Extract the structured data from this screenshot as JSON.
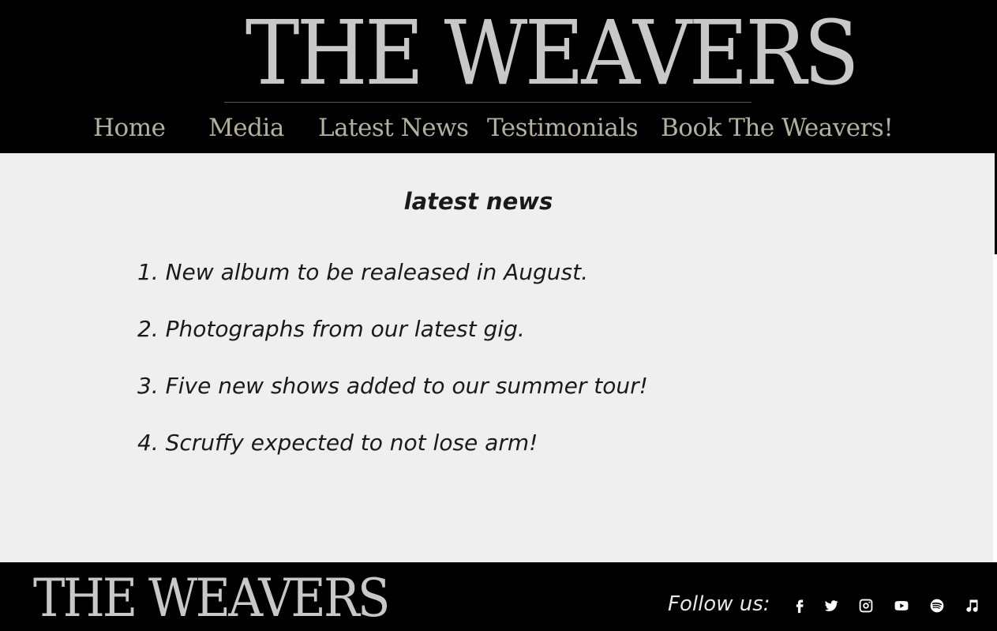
{
  "header": {
    "logo_text": "THE WEAVERS"
  },
  "nav": {
    "items": [
      {
        "label": "Home"
      },
      {
        "label": "Media"
      },
      {
        "label": "Latest News"
      },
      {
        "label": "Testimonials"
      },
      {
        "label": "Book The Weavers!"
      }
    ]
  },
  "main": {
    "title": "latest news",
    "news": [
      "1. New album to be realeased in August.",
      "2. Photographs from our latest gig.",
      "3. Five new shows added to our summer tour!",
      "4. Scruffy expected to not lose arm!"
    ]
  },
  "footer": {
    "logo_text": "THE WEAVERS",
    "follow_label": "Follow us:",
    "social_icons": [
      "facebook-icon",
      "twitter-icon",
      "instagram-icon",
      "youtube-icon",
      "spotify-icon",
      "music-note-icon"
    ]
  },
  "colors": {
    "background": "#000000",
    "content_bg": "#efefef",
    "nav_text": "#b4b09e",
    "logo_text": "#c8c8c8"
  }
}
